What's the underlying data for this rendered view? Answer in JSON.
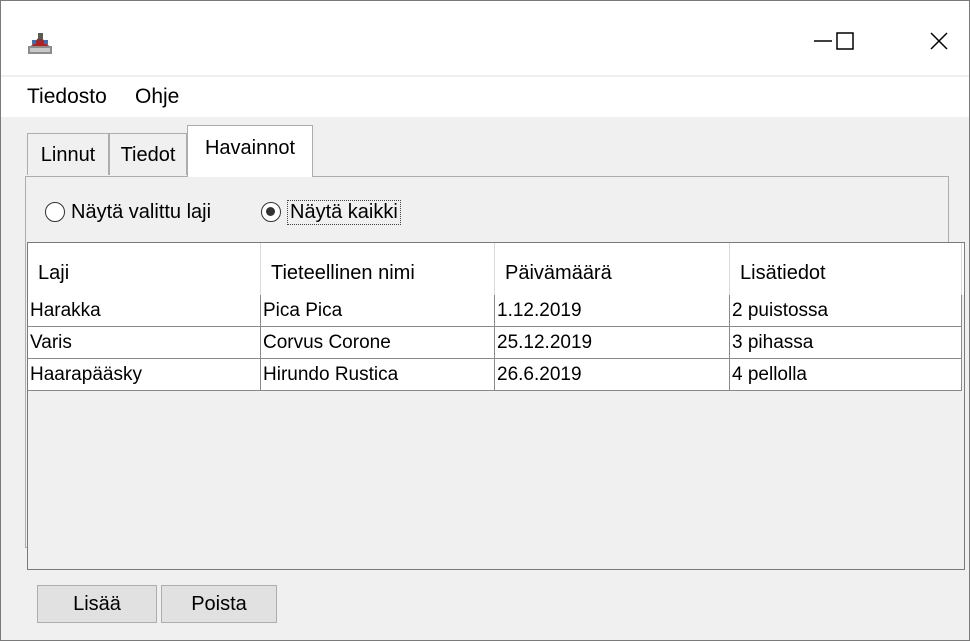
{
  "window": {
    "icon": "java-app-icon",
    "controls": {
      "minimize_icon": "minimize-icon",
      "maximize_icon": "maximize-icon",
      "close_icon": "close-icon"
    }
  },
  "menubar": {
    "file": "Tiedosto",
    "help": "Ohje"
  },
  "tabs": [
    {
      "label": "Linnut",
      "active": false
    },
    {
      "label": "Tiedot",
      "active": false
    },
    {
      "label": "Havainnot",
      "active": true
    }
  ],
  "filter": {
    "selected_species_label": "Näytä valittu laji",
    "show_all_label": "Näytä kaikki",
    "selected": "show_all"
  },
  "table": {
    "columns": [
      "Laji",
      "Tieteellinen nimi",
      "Päivämäärä",
      "Lisätiedot"
    ],
    "rows": [
      [
        "Harakka",
        "Pica Pica",
        "1.12.2019",
        "2 puistossa"
      ],
      [
        "Varis",
        "Corvus Corone",
        "25.12.2019",
        "3 pihassa"
      ],
      [
        "Haarapääsky",
        "Hirundo Rustica",
        "26.6.2019",
        "4 pellolla"
      ]
    ]
  },
  "buttons": {
    "add": "Lisää",
    "delete": "Poista"
  }
}
